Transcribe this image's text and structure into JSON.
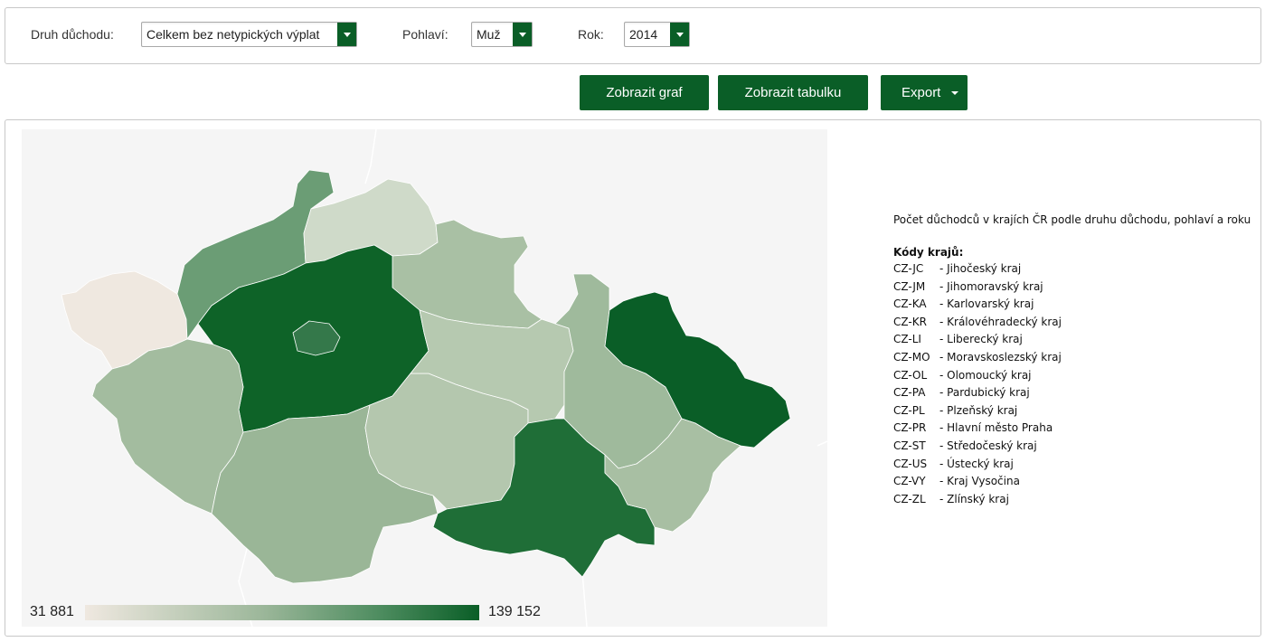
{
  "filters": {
    "druh_label": "Druh důchodu:",
    "druh_value": "Celkem bez netypických výplat",
    "pohlavi_label": "Pohlaví:",
    "pohlavi_value": "Muž",
    "rok_label": "Rok:",
    "rok_value": "2014"
  },
  "buttons": {
    "show_chart": "Zobrazit graf",
    "show_table": "Zobrazit tabulku",
    "export": "Export"
  },
  "map": {
    "scale_min": "31 881",
    "scale_max": "139 152",
    "colors": {
      "CZ-KA": "#efe8e0",
      "CZ-US": "#6b9d75",
      "CZ-LI": "#cfdac9",
      "CZ-KR": "#a9c0a4",
      "CZ-ST": "#0e6328",
      "CZ-PR": "#34784a",
      "CZ-PL": "#a3bc9f",
      "CZ-JC": "#9ab697",
      "CZ-VY": "#b4c7ae",
      "CZ-PA": "#b6c9b0",
      "CZ-OL": "#9fba9c",
      "CZ-MO": "#0a5e27",
      "CZ-JM": "#1f6e37",
      "CZ-ZL": "#a8bfa3"
    }
  },
  "info": {
    "title": "Počet důchodců v krajích ČR podle druhu důchodu, pohlaví a roku",
    "codes_header": "Kódy krajů:",
    "regions": [
      {
        "code": "CZ-JC",
        "name": "- Jihočeský kraj"
      },
      {
        "code": "CZ-JM",
        "name": "- Jihomoravský kraj"
      },
      {
        "code": "CZ-KA",
        "name": "- Karlovarský kraj"
      },
      {
        "code": "CZ-KR",
        "name": "- Královéhradecký kraj"
      },
      {
        "code": "CZ-LI",
        "name": "- Liberecký kraj"
      },
      {
        "code": "CZ-MO",
        "name": "- Moravskoslezský kraj"
      },
      {
        "code": "CZ-OL",
        "name": "- Olomoucký kraj"
      },
      {
        "code": "CZ-PA",
        "name": "- Pardubický kraj"
      },
      {
        "code": "CZ-PL",
        "name": "- Plzeňský kraj"
      },
      {
        "code": "CZ-PR",
        "name": "- Hlavní město Praha"
      },
      {
        "code": "CZ-ST",
        "name": "- Středočeský kraj"
      },
      {
        "code": "CZ-US",
        "name": "- Ústecký kraj"
      },
      {
        "code": "CZ-VY",
        "name": "- Kraj Vysočina"
      },
      {
        "code": "CZ-ZL",
        "name": "- Zlínský kraj"
      }
    ]
  }
}
